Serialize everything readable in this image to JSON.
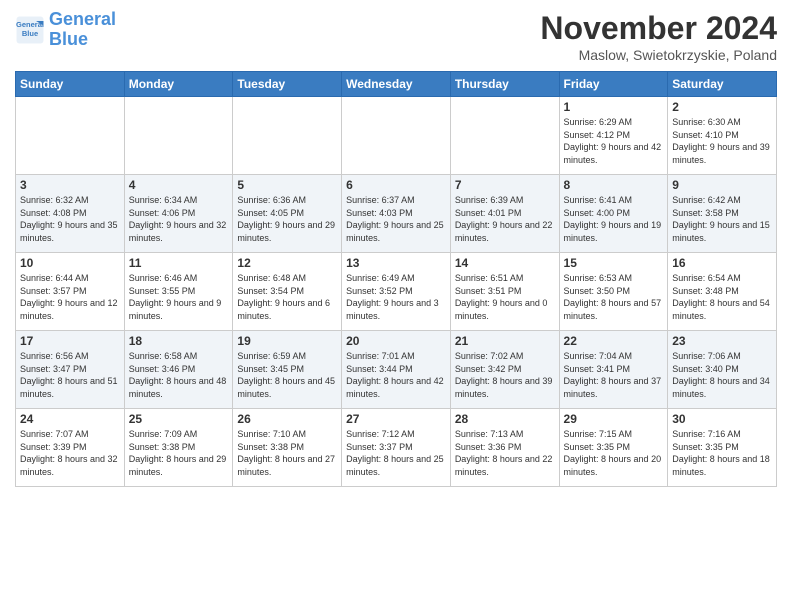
{
  "logo": {
    "line1": "General",
    "line2": "Blue"
  },
  "header": {
    "month": "November 2024",
    "location": "Maslow, Swietokrzyskie, Poland"
  },
  "weekdays": [
    "Sunday",
    "Monday",
    "Tuesday",
    "Wednesday",
    "Thursday",
    "Friday",
    "Saturday"
  ],
  "weeks": [
    [
      {
        "day": "",
        "info": ""
      },
      {
        "day": "",
        "info": ""
      },
      {
        "day": "",
        "info": ""
      },
      {
        "day": "",
        "info": ""
      },
      {
        "day": "",
        "info": ""
      },
      {
        "day": "1",
        "info": "Sunrise: 6:29 AM\nSunset: 4:12 PM\nDaylight: 9 hours\nand 42 minutes."
      },
      {
        "day": "2",
        "info": "Sunrise: 6:30 AM\nSunset: 4:10 PM\nDaylight: 9 hours\nand 39 minutes."
      }
    ],
    [
      {
        "day": "3",
        "info": "Sunrise: 6:32 AM\nSunset: 4:08 PM\nDaylight: 9 hours\nand 35 minutes."
      },
      {
        "day": "4",
        "info": "Sunrise: 6:34 AM\nSunset: 4:06 PM\nDaylight: 9 hours\nand 32 minutes."
      },
      {
        "day": "5",
        "info": "Sunrise: 6:36 AM\nSunset: 4:05 PM\nDaylight: 9 hours\nand 29 minutes."
      },
      {
        "day": "6",
        "info": "Sunrise: 6:37 AM\nSunset: 4:03 PM\nDaylight: 9 hours\nand 25 minutes."
      },
      {
        "day": "7",
        "info": "Sunrise: 6:39 AM\nSunset: 4:01 PM\nDaylight: 9 hours\nand 22 minutes."
      },
      {
        "day": "8",
        "info": "Sunrise: 6:41 AM\nSunset: 4:00 PM\nDaylight: 9 hours\nand 19 minutes."
      },
      {
        "day": "9",
        "info": "Sunrise: 6:42 AM\nSunset: 3:58 PM\nDaylight: 9 hours\nand 15 minutes."
      }
    ],
    [
      {
        "day": "10",
        "info": "Sunrise: 6:44 AM\nSunset: 3:57 PM\nDaylight: 9 hours\nand 12 minutes."
      },
      {
        "day": "11",
        "info": "Sunrise: 6:46 AM\nSunset: 3:55 PM\nDaylight: 9 hours\nand 9 minutes."
      },
      {
        "day": "12",
        "info": "Sunrise: 6:48 AM\nSunset: 3:54 PM\nDaylight: 9 hours\nand 6 minutes."
      },
      {
        "day": "13",
        "info": "Sunrise: 6:49 AM\nSunset: 3:52 PM\nDaylight: 9 hours\nand 3 minutes."
      },
      {
        "day": "14",
        "info": "Sunrise: 6:51 AM\nSunset: 3:51 PM\nDaylight: 9 hours\nand 0 minutes."
      },
      {
        "day": "15",
        "info": "Sunrise: 6:53 AM\nSunset: 3:50 PM\nDaylight: 8 hours\nand 57 minutes."
      },
      {
        "day": "16",
        "info": "Sunrise: 6:54 AM\nSunset: 3:48 PM\nDaylight: 8 hours\nand 54 minutes."
      }
    ],
    [
      {
        "day": "17",
        "info": "Sunrise: 6:56 AM\nSunset: 3:47 PM\nDaylight: 8 hours\nand 51 minutes."
      },
      {
        "day": "18",
        "info": "Sunrise: 6:58 AM\nSunset: 3:46 PM\nDaylight: 8 hours\nand 48 minutes."
      },
      {
        "day": "19",
        "info": "Sunrise: 6:59 AM\nSunset: 3:45 PM\nDaylight: 8 hours\nand 45 minutes."
      },
      {
        "day": "20",
        "info": "Sunrise: 7:01 AM\nSunset: 3:44 PM\nDaylight: 8 hours\nand 42 minutes."
      },
      {
        "day": "21",
        "info": "Sunrise: 7:02 AM\nSunset: 3:42 PM\nDaylight: 8 hours\nand 39 minutes."
      },
      {
        "day": "22",
        "info": "Sunrise: 7:04 AM\nSunset: 3:41 PM\nDaylight: 8 hours\nand 37 minutes."
      },
      {
        "day": "23",
        "info": "Sunrise: 7:06 AM\nSunset: 3:40 PM\nDaylight: 8 hours\nand 34 minutes."
      }
    ],
    [
      {
        "day": "24",
        "info": "Sunrise: 7:07 AM\nSunset: 3:39 PM\nDaylight: 8 hours\nand 32 minutes."
      },
      {
        "day": "25",
        "info": "Sunrise: 7:09 AM\nSunset: 3:38 PM\nDaylight: 8 hours\nand 29 minutes."
      },
      {
        "day": "26",
        "info": "Sunrise: 7:10 AM\nSunset: 3:38 PM\nDaylight: 8 hours\nand 27 minutes."
      },
      {
        "day": "27",
        "info": "Sunrise: 7:12 AM\nSunset: 3:37 PM\nDaylight: 8 hours\nand 25 minutes."
      },
      {
        "day": "28",
        "info": "Sunrise: 7:13 AM\nSunset: 3:36 PM\nDaylight: 8 hours\nand 22 minutes."
      },
      {
        "day": "29",
        "info": "Sunrise: 7:15 AM\nSunset: 3:35 PM\nDaylight: 8 hours\nand 20 minutes."
      },
      {
        "day": "30",
        "info": "Sunrise: 7:16 AM\nSunset: 3:35 PM\nDaylight: 8 hours\nand 18 minutes."
      }
    ]
  ]
}
